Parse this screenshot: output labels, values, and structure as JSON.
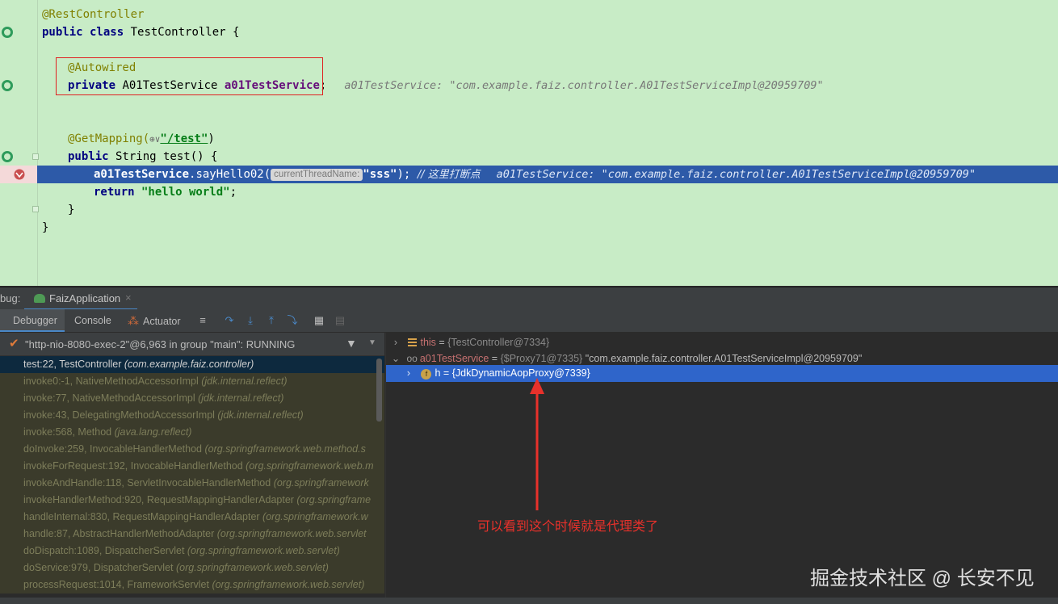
{
  "editor": {
    "lines": {
      "l1": "@RestController",
      "l2_kw": "public class",
      "l2_rest": " TestController {",
      "l3_ann": "@Autowired",
      "l4_kw": "private",
      "l4_type": " A01TestService ",
      "l4_field": "a01TestService",
      "l4_semi": ";",
      "l4_hint": "a01TestService: \"com.example.faiz.controller.A01TestServiceImpl@20959709\"",
      "l5_ann": "@GetMapping(",
      "l5_icon": "⊕∨",
      "l5_url": "\"/test\"",
      "l5_close": ")",
      "l6_kw": "public",
      "l6_rest": " String test() {",
      "l7_field": "a01TestService",
      "l7_call": ".sayHello02(",
      "l7_param": "currentThreadName:",
      "l7_str": "\"sss\"",
      "l7_end": "); ",
      "l7_comment": "// 这里打断点",
      "l7_hint": "a01TestService: \"com.example.faiz.controller.A01TestServiceImpl@20959709\"",
      "l8_kw": "return",
      "l8_str": " \"hello world\"",
      "l8_semi": ";",
      "l9": "}",
      "l10": "}"
    }
  },
  "debug": {
    "title_label": "bug:",
    "run_config": "FaizApplication",
    "close": "×",
    "tabs": {
      "debugger": "Debugger",
      "console": "Console",
      "actuator": "Actuator"
    },
    "thread": "\"http-nio-8080-exec-2\"@6,963 in group \"main\": RUNNING",
    "frames": [
      {
        "method": "test:22, TestController ",
        "pkg": "(com.example.faiz.controller)"
      },
      {
        "method": "invoke0:-1, NativeMethodAccessorImpl ",
        "pkg": "(jdk.internal.reflect)"
      },
      {
        "method": "invoke:77, NativeMethodAccessorImpl ",
        "pkg": "(jdk.internal.reflect)"
      },
      {
        "method": "invoke:43, DelegatingMethodAccessorImpl ",
        "pkg": "(jdk.internal.reflect)"
      },
      {
        "method": "invoke:568, Method ",
        "pkg": "(java.lang.reflect)"
      },
      {
        "method": "doInvoke:259, InvocableHandlerMethod ",
        "pkg": "(org.springframework.web.method.s"
      },
      {
        "method": "invokeForRequest:192, InvocableHandlerMethod ",
        "pkg": "(org.springframework.web.m"
      },
      {
        "method": "invokeAndHandle:118, ServletInvocableHandlerMethod ",
        "pkg": "(org.springframework"
      },
      {
        "method": "invokeHandlerMethod:920, RequestMappingHandlerAdapter ",
        "pkg": "(org.springframe"
      },
      {
        "method": "handleInternal:830, RequestMappingHandlerAdapter ",
        "pkg": "(org.springframework.w"
      },
      {
        "method": "handle:87, AbstractHandlerMethodAdapter ",
        "pkg": "(org.springframework.web.servlet"
      },
      {
        "method": "doDispatch:1089, DispatcherServlet ",
        "pkg": "(org.springframework.web.servlet)"
      },
      {
        "method": "doService:979, DispatcherServlet ",
        "pkg": "(org.springframework.web.servlet)"
      },
      {
        "method": "processRequest:1014, FrameworkServlet ",
        "pkg": "(org.springframework.web.servlet)"
      }
    ],
    "variables": {
      "this_name": "this",
      "this_eq": " = ",
      "this_val": "{TestController@7334}",
      "svc_name": "a01TestService",
      "svc_eq": " = ",
      "svc_type": "{$Proxy71@7335}",
      "svc_val": " \"com.example.faiz.controller.A01TestServiceImpl@20959709\"",
      "h_name": "h",
      "h_eq": " = ",
      "h_val": "{JdkDynamicAopProxy@7339}",
      "field_badge": "f"
    }
  },
  "annotation_note": "可以看到这个时候就是代理类了",
  "watermark": "掘金技术社区 @ 长安不见",
  "colors": {
    "editor_bg": "#c8ecc6",
    "exec_line": "#2d5aa8",
    "selection": "#2f65ca",
    "annotation": "#e8312b"
  }
}
